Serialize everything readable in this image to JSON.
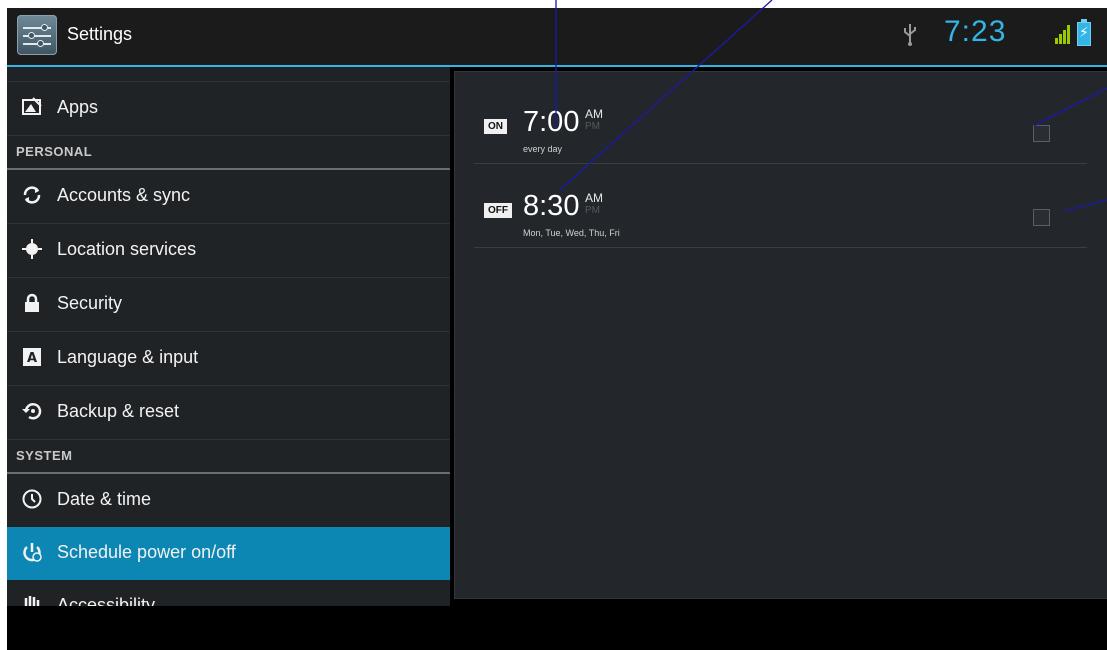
{
  "actionbar": {
    "title": "Settings",
    "clock": "7:23",
    "icons": [
      "settings-app-icon",
      "usb-icon",
      "signal-icon",
      "battery-charging-icon"
    ],
    "accent_color": "#33b5e5"
  },
  "sidebar": {
    "items": [
      {
        "type": "item",
        "label": "Apps",
        "icon": "apps-icon"
      },
      {
        "type": "header",
        "label": "PERSONAL"
      },
      {
        "type": "item",
        "label": "Accounts & sync",
        "icon": "sync-icon"
      },
      {
        "type": "item",
        "label": "Location services",
        "icon": "location-icon"
      },
      {
        "type": "item",
        "label": "Security",
        "icon": "lock-icon"
      },
      {
        "type": "item",
        "label": "Language & input",
        "icon": "language-icon"
      },
      {
        "type": "item",
        "label": "Backup & reset",
        "icon": "backup-icon"
      },
      {
        "type": "header",
        "label": "SYSTEM"
      },
      {
        "type": "item",
        "label": "Date & time",
        "icon": "clock-icon"
      },
      {
        "type": "item",
        "label": "Schedule power on/off",
        "icon": "power-schedule-icon",
        "selected": true
      },
      {
        "type": "item",
        "label": "Accessibility",
        "icon": "accessibility-icon"
      }
    ],
    "selected_color": "#0c86b3"
  },
  "schedules": [
    {
      "badge": "ON",
      "time": "7:00",
      "am": "AM",
      "pm": "PM",
      "days": "every day",
      "checked": false
    },
    {
      "badge": "OFF",
      "time": "8:30",
      "am": "AM",
      "pm": "PM",
      "days": "Mon, Tue, Wed, Thu, Fri",
      "checked": false
    }
  ]
}
